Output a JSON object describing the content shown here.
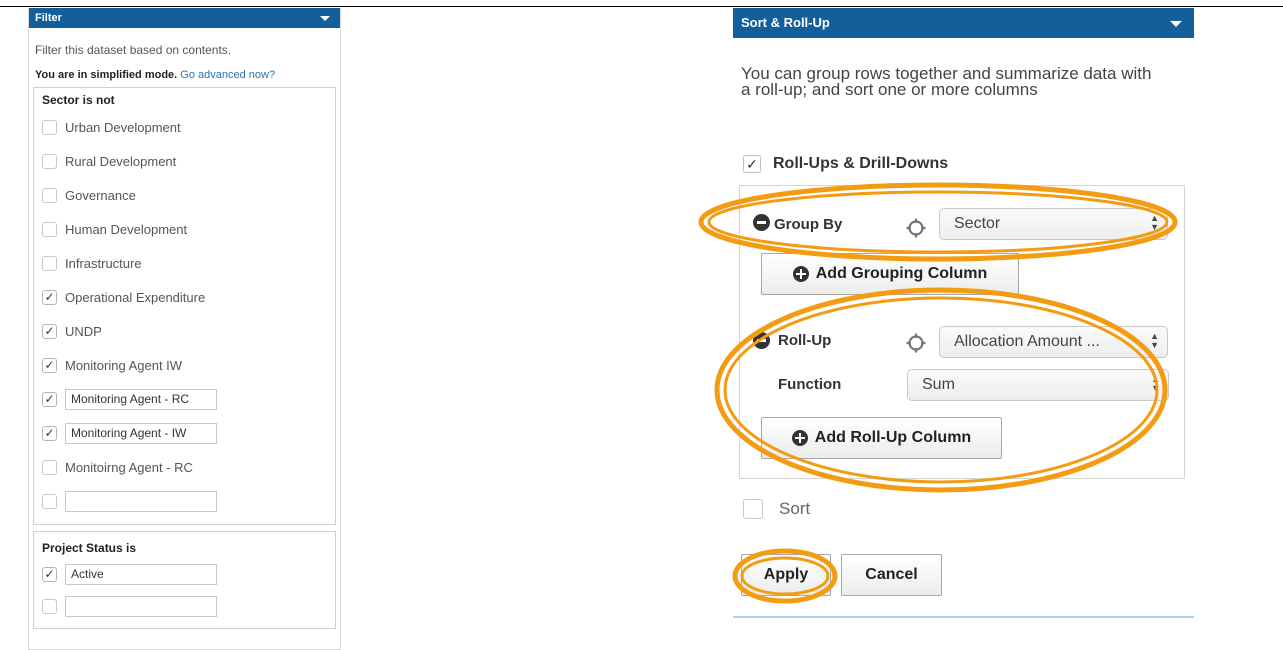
{
  "filter": {
    "header": "Filter",
    "description": "Filter this dataset based on contents.",
    "mode_text": "You are in simplified mode.",
    "advanced_link": "Go advanced now?",
    "conditions": [
      {
        "title": "Sector  is not",
        "options": [
          {
            "label": "Urban Development",
            "checked": false
          },
          {
            "label": "Rural Development",
            "checked": false
          },
          {
            "label": "Governance",
            "checked": false
          },
          {
            "label": "Human Development",
            "checked": false
          },
          {
            "label": "Infrastructure",
            "checked": false
          },
          {
            "label": "Operational Expenditure",
            "checked": true
          },
          {
            "label": "UNDP",
            "checked": true
          },
          {
            "label": "Monitoring Agent IW",
            "checked": true
          },
          {
            "input_value": "Monitoring Agent - RC",
            "checked": true
          },
          {
            "input_value": "Monitoring Agent - IW",
            "checked": true
          },
          {
            "label": "Monitoirng Agent - RC",
            "checked": false
          },
          {
            "input_value": "",
            "checked": false
          }
        ]
      },
      {
        "title": "Project Status  is",
        "options": [
          {
            "input_value": "Active",
            "checked": true
          },
          {
            "input_value": "",
            "checked": false
          }
        ]
      }
    ]
  },
  "sort_rollup": {
    "header": "Sort & Roll-Up",
    "description": "You can group rows together and summarize data with a roll-up; and sort one or more columns",
    "rollups_label": "Roll-Ups & Drill-Downs",
    "rollups_checked": true,
    "group_by_label": "Group By",
    "group_by_value": "Sector",
    "add_grouping_label": "Add Grouping Column",
    "rollup_label": "Roll-Up",
    "rollup_value": "Allocation Amount ...",
    "function_label": "Function",
    "function_value": "Sum",
    "add_rollup_label": "Add Roll-Up Column",
    "sort_label": "Sort",
    "sort_checked": false,
    "apply_label": "Apply",
    "cancel_label": "Cancel"
  },
  "colors": {
    "header_blue": "#135f9c",
    "annotation_orange": "#f39c12",
    "link_blue": "#2f73b6"
  },
  "icons": [
    "caret-down-icon",
    "check-icon",
    "minus-circle-icon",
    "plus-circle-icon",
    "crosshair-icon",
    "select-arrows-icon"
  ]
}
